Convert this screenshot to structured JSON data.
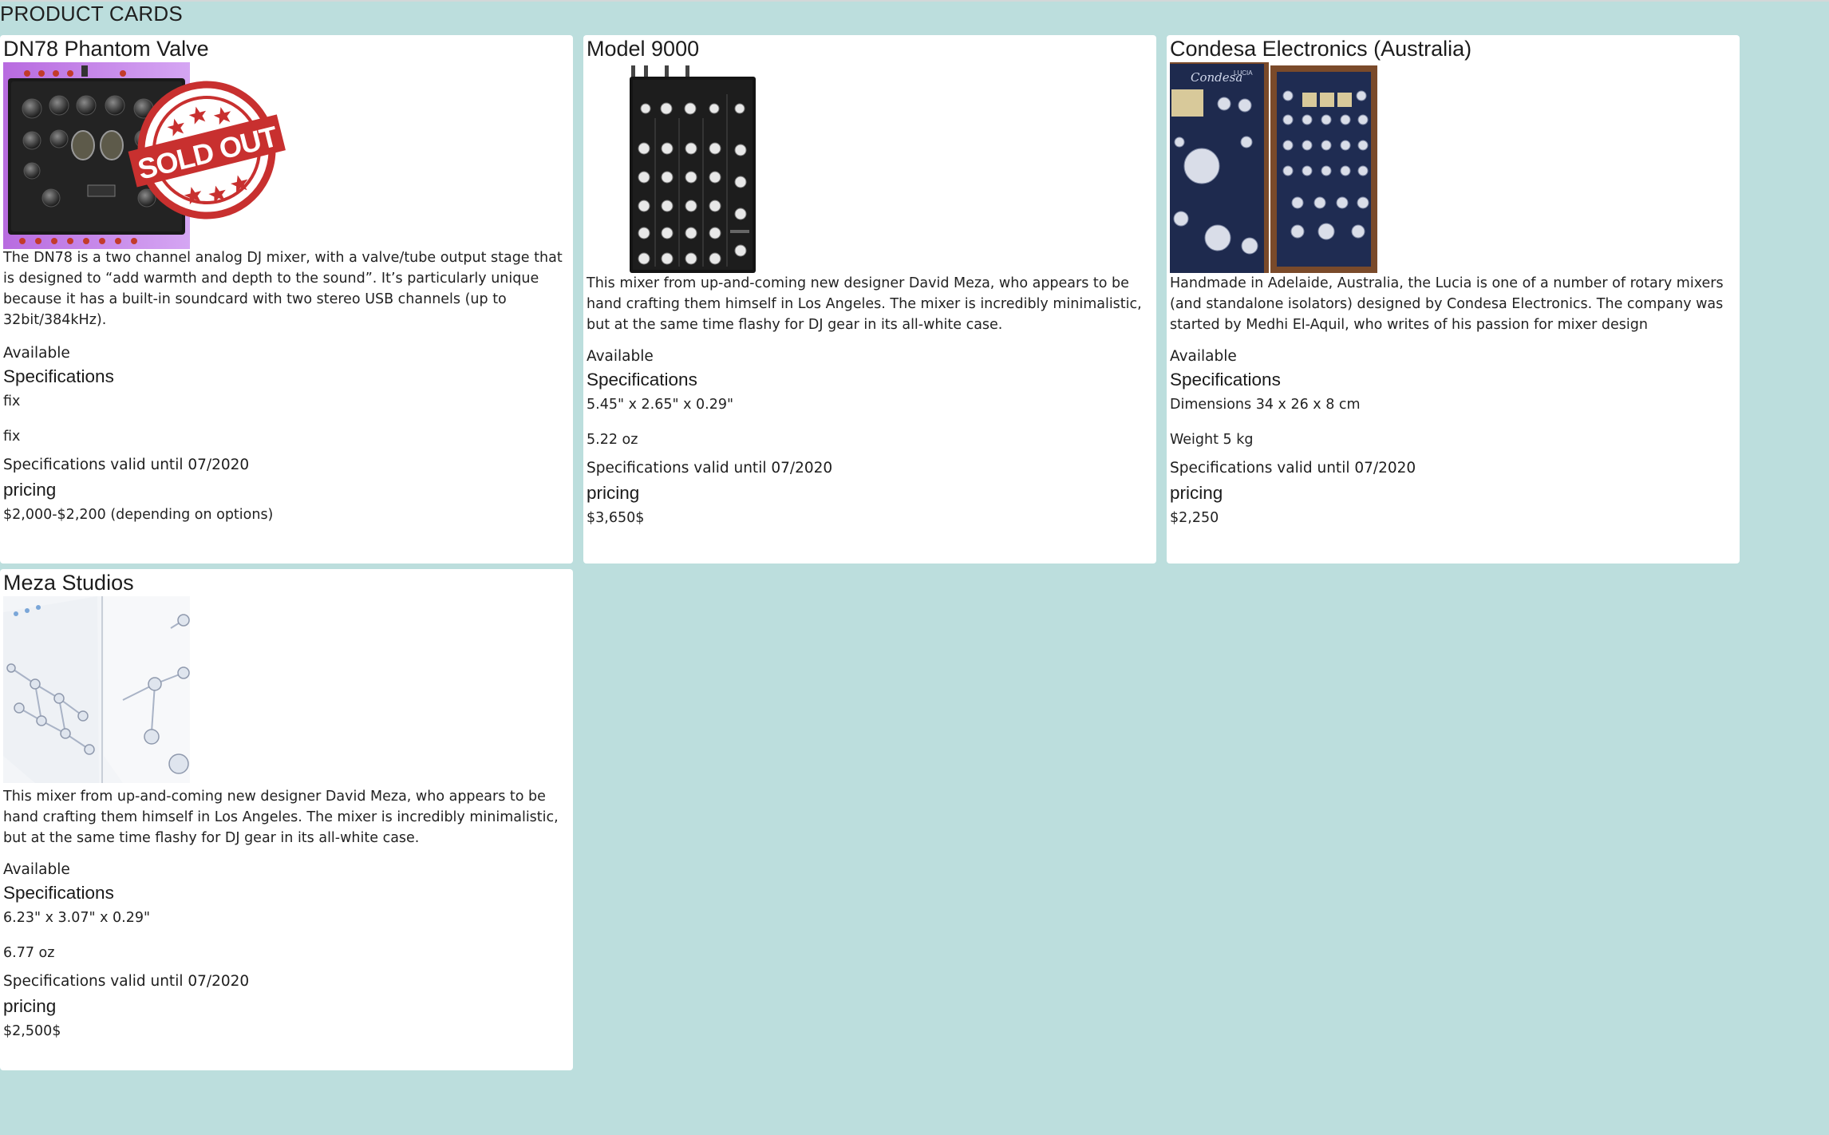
{
  "page": {
    "heading": "PRODUCT CARDS"
  },
  "colors": {
    "background": "#bcdedd",
    "card": "#ffffff",
    "sold_out_stamp": "#c8302f"
  },
  "cards": [
    {
      "title": "DN78 Phantom Valve",
      "image_icon": "dj-mixer-photo",
      "stamp": "SOLD OUT",
      "description": "The DN78 is a two channel analog DJ mixer, with a valve/tube output stage that is designed to “add warmth and depth to the sound”. It’s particularly unique because it has a built-in soundcard with two stereo USB channels (up to 32bit/384kHz).",
      "status": "Available",
      "spec_heading": "Specifications",
      "specs": [
        "fix",
        "fix"
      ],
      "valid_until": "Specifications valid until 07/2020",
      "price_heading": "pricing",
      "price": "$2,000-$2,200 (depending on options)"
    },
    {
      "title": "Model 9000",
      "image_icon": "rotary-mixer-photo",
      "description": "This mixer from up-and-coming new designer David Meza, who appears to be hand crafting them himself in Los Angeles. The mixer is incredibly minimalistic, but at the same time flashy for DJ gear in its all-white case.",
      "status": "Available",
      "spec_heading": "Specifications",
      "specs": [
        "5.45\" x 2.65\" x 0.29\"",
        "5.22 oz"
      ],
      "valid_until": "Specifications valid until 07/2020",
      "price_heading": "pricing",
      "price": "$3,650$"
    },
    {
      "title": "Condesa Electronics (Australia)",
      "image_icon": "condesa-lucia-mixer-photo",
      "image_label_1": "Condesa",
      "image_label_2": "LUCIA",
      "description": "Handmade in Adelaide, Australia, the Lucia is one of a number of rotary mixers (and standalone isolators) designed by Condesa Electronics. The company was started by Medhi El-Aquil, who writes of his passion for mixer design",
      "status": "Available",
      "spec_heading": "Specifications",
      "specs": [
        "Dimensions 34 x 26 x 8 cm",
        "Weight 5 kg"
      ],
      "valid_until": "Specifications valid until 07/2020",
      "price_heading": "pricing",
      "price": "$2,250"
    },
    {
      "title": "Meza Studios",
      "image_icon": "white-mixer-photo",
      "description": "This mixer from up-and-coming new designer David Meza, who appears to be hand crafting them himself in Los Angeles. The mixer is incredibly minimalistic, but at the same time flashy for DJ gear in its all-white case.",
      "status": "Available",
      "spec_heading": "Specifications",
      "specs": [
        "6.23\" x 3.07\" x 0.29\"",
        "6.77 oz"
      ],
      "valid_until": "Specifications valid until 07/2020",
      "price_heading": "pricing",
      "price": "$2,500$"
    }
  ]
}
